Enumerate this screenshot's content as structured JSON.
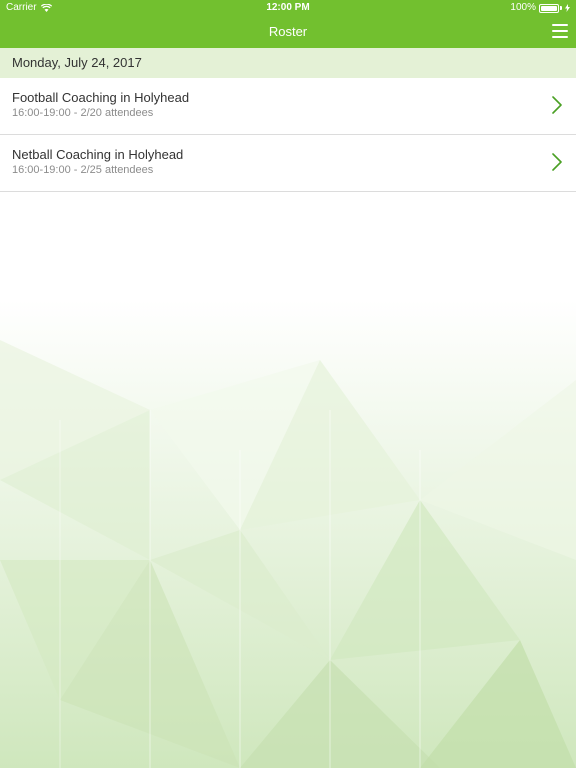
{
  "status_bar": {
    "carrier": "Carrier",
    "time": "12:00 PM",
    "battery": "100%",
    "battery_color": "#ffffff"
  },
  "navbar": {
    "title": "Roster",
    "menu_icon": "hamburger-menu-icon",
    "background": "#72c02f"
  },
  "date_header": {
    "label": "Monday, July 24, 2017",
    "background": "#e4f1d6"
  },
  "sessions": [
    {
      "title": "Football Coaching in Holyhead",
      "subtitle": "16:00-19:00 - 2/20 attendees",
      "icon": "chevron-right-icon"
    },
    {
      "title": "Netball Coaching in Holyhead",
      "subtitle": "16:00-19:00 - 2/25 attendees",
      "icon": "chevron-right-icon"
    }
  ],
  "colors": {
    "accent": "#72c02f",
    "chevron": "#4aa024",
    "subtitle_text": "#8c8c8c"
  }
}
